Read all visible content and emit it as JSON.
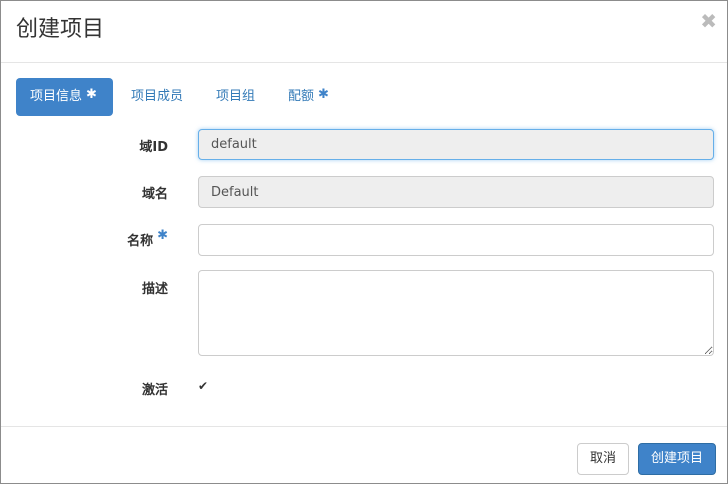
{
  "dialog": {
    "title": "创建项目",
    "close_symbol": "✖"
  },
  "tabs": [
    {
      "label": "项目信息",
      "required_mark": "✱",
      "active": true
    },
    {
      "label": "项目成员"
    },
    {
      "label": "项目组"
    },
    {
      "label": "配额",
      "required_mark": "✱"
    }
  ],
  "form": {
    "domain_id": {
      "label": "域ID",
      "value": "default"
    },
    "domain_name": {
      "label": "域名",
      "value": "Default"
    },
    "name": {
      "label": "名称",
      "required_mark": "✱",
      "value": ""
    },
    "description": {
      "label": "描述",
      "value": ""
    },
    "enabled": {
      "label": "激活",
      "checked": true,
      "check_symbol": "✔"
    }
  },
  "footer": {
    "cancel_label": "取消",
    "submit_label": "创建项目"
  },
  "colors": {
    "primary": "#3f83c9",
    "link": "#337ab7",
    "readonly_bg": "#eeeeee"
  }
}
